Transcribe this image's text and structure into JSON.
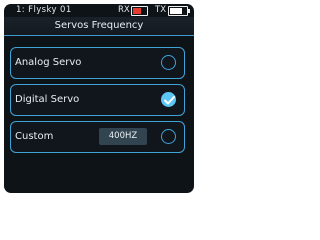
{
  "status_bar": {
    "model_label": "1: Flysky 01",
    "rx_label": "RX",
    "tx_label": "TX",
    "rx_signal_level": 0.6,
    "tx_battery_level": 0.75
  },
  "title": "Servos Frequency",
  "options": [
    {
      "label": "Analog Servo",
      "selected": false
    },
    {
      "label": "Digital Servo",
      "selected": true
    },
    {
      "label": "Custom",
      "value": "400HZ",
      "selected": false
    }
  ],
  "colors": {
    "accent": "#3fa3d8",
    "selected": "#5cc6f4",
    "rx_bar": "#e53b2e",
    "screen_bg": "#0e1318"
  },
  "icons": [
    "checkmark-icon",
    "radio-empty-icon",
    "battery-icon",
    "signal-bar-icon"
  ]
}
